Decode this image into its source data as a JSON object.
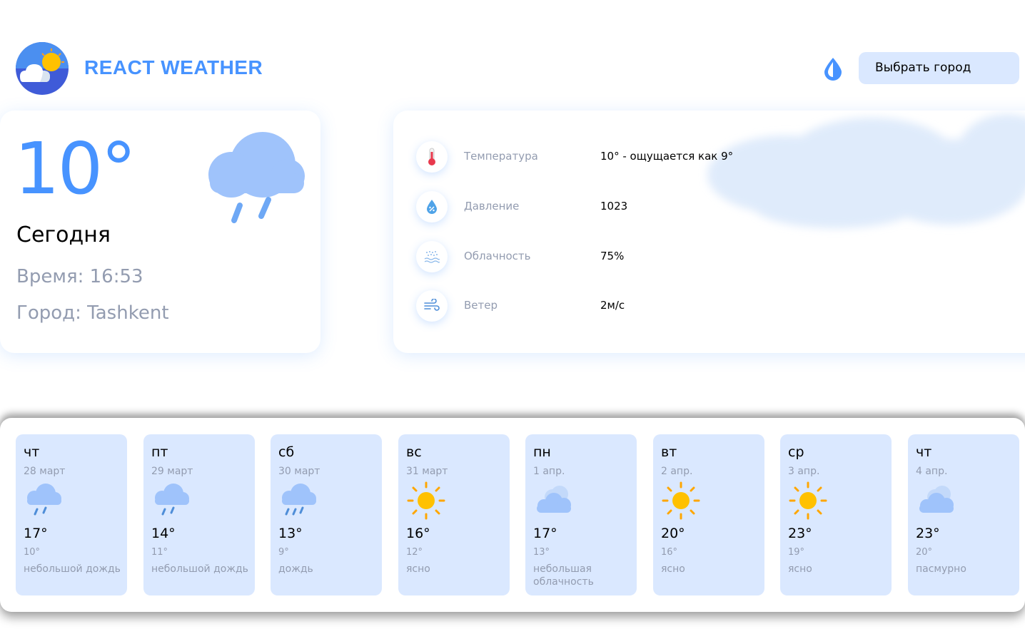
{
  "header": {
    "brand": "REACT WEATHER",
    "city_select_label": "Выбрать город"
  },
  "today": {
    "temperature": "10°",
    "day": "Сегодня",
    "time": "Время: 16:53",
    "city": "Город: Tashkent",
    "icon": "rain-cloud-icon"
  },
  "details": [
    {
      "icon": "thermometer-icon",
      "label": "Температура",
      "value": "10° - ощущается как 9°"
    },
    {
      "icon": "pressure-drop-icon",
      "label": "Давление",
      "value": "1023"
    },
    {
      "icon": "precipitation-icon",
      "label": "Облачность",
      "value": "75%"
    },
    {
      "icon": "wind-icon",
      "label": "Ветер",
      "value": "2м/с"
    }
  ],
  "forecast": [
    {
      "day": "чт",
      "date": "28 март",
      "temp": "17°",
      "temp_min": "10°",
      "desc": "небольшой дождь",
      "icon": "rain"
    },
    {
      "day": "пт",
      "date": "29 март",
      "temp": "14°",
      "temp_min": "11°",
      "desc": "небольшой дождь",
      "icon": "rain"
    },
    {
      "day": "сб",
      "date": "30 март",
      "temp": "13°",
      "temp_min": "9°",
      "desc": "дождь",
      "icon": "heavy-rain"
    },
    {
      "day": "вс",
      "date": "31 март",
      "temp": "16°",
      "temp_min": "12°",
      "desc": "ясно",
      "icon": "sun"
    },
    {
      "day": "пн",
      "date": "1 апр.",
      "temp": "17°",
      "temp_min": "13°",
      "desc": "небольшая облачность",
      "icon": "cloud"
    },
    {
      "day": "вт",
      "date": "2 апр.",
      "temp": "20°",
      "temp_min": "16°",
      "desc": "ясно",
      "icon": "sun"
    },
    {
      "day": "ср",
      "date": "3 апр.",
      "temp": "23°",
      "temp_min": "19°",
      "desc": "ясно",
      "icon": "sun"
    },
    {
      "day": "чт",
      "date": "4 апр.",
      "temp": "23°",
      "temp_min": "20°",
      "desc": "пасмурно",
      "icon": "cloud"
    }
  ],
  "colors": {
    "accent": "#4793ff",
    "card_bg": "#dae8ff",
    "muted_text": "#939cb0",
    "sun": "#ffc100"
  }
}
